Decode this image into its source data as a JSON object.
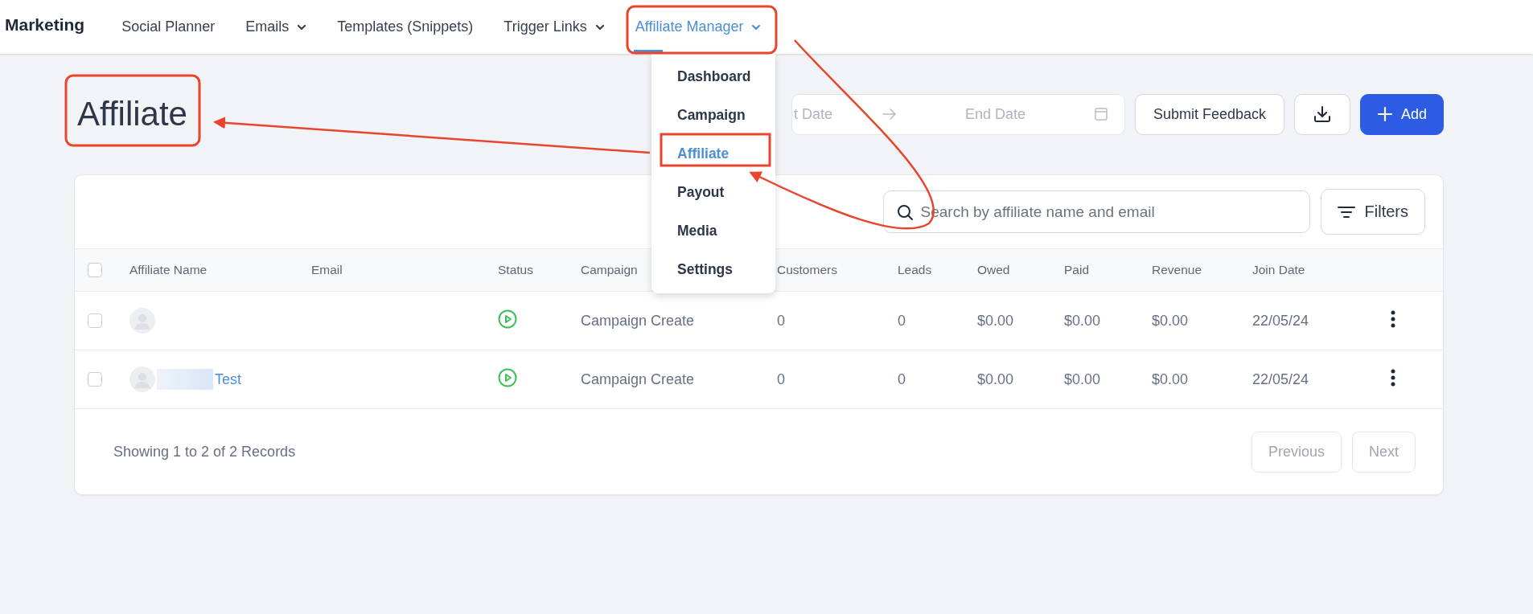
{
  "nav": {
    "brand": "Marketing",
    "items": [
      {
        "label": "Social Planner",
        "has_menu": false,
        "selected": false
      },
      {
        "label": "Emails",
        "has_menu": true,
        "selected": false
      },
      {
        "label": "Templates (Snippets)",
        "has_menu": false,
        "selected": false
      },
      {
        "label": "Trigger Links",
        "has_menu": true,
        "selected": false
      },
      {
        "label": "Affiliate Manager",
        "has_menu": true,
        "selected": true
      }
    ]
  },
  "dropdown": {
    "items": [
      {
        "label": "Dashboard",
        "selected": false
      },
      {
        "label": "Campaign",
        "selected": false
      },
      {
        "label": "Affiliate",
        "selected": true
      },
      {
        "label": "Payout",
        "selected": false
      },
      {
        "label": "Media",
        "selected": false
      },
      {
        "label": "Settings",
        "selected": false
      }
    ]
  },
  "page": {
    "title": "Affiliate"
  },
  "date_range": {
    "start": {
      "placeholder": "t Date"
    },
    "end": {
      "placeholder": "End Date"
    }
  },
  "actions": {
    "feedback": "Submit Feedback",
    "add": "Add"
  },
  "search": {
    "placeholder": "Search by affiliate name and email"
  },
  "filters": "Filters",
  "table": {
    "header_checked": false,
    "columns": [
      "Affiliate Name",
      "Email",
      "Status",
      "Campaign",
      "Customers",
      "Leads",
      "Owed",
      "Paid",
      "Revenue",
      "Join Date"
    ],
    "rows": [
      {
        "checked": false,
        "campaign": "Campaign Create",
        "customers": "0",
        "leads": "0",
        "owed": "$0.00",
        "paid": "$0.00",
        "revenue": "$0.00",
        "join_date": "22/05/24"
      },
      {
        "checked": false,
        "name": "Test",
        "campaign": "Campaign Create",
        "customers": "0",
        "leads": "0",
        "owed": "$0.00",
        "paid": "$0.00",
        "revenue": "$0.00",
        "join_date": "22/05/24"
      }
    ]
  },
  "footer": {
    "summary": "Showing 1 to 2 of 2 Records",
    "buttons": [
      {
        "label": "Previous",
        "disabled": true
      },
      {
        "label": "Next",
        "disabled": true
      }
    ]
  }
}
